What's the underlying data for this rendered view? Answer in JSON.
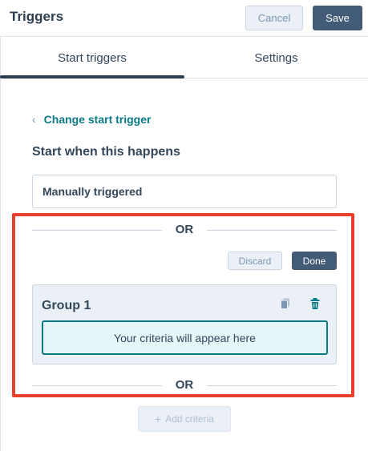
{
  "header": {
    "title": "Triggers",
    "cancel_label": "Cancel",
    "save_label": "Save"
  },
  "tabs": [
    {
      "label": "Start triggers",
      "active": true
    },
    {
      "label": "Settings",
      "active": false
    }
  ],
  "back_link": {
    "chevron": "‹",
    "label": "Change start trigger"
  },
  "section": {
    "heading": "Start when this happens",
    "trigger_value": "Manually triggered"
  },
  "or_label": "OR",
  "editor": {
    "discard_label": "Discard",
    "done_label": "Done",
    "group": {
      "title": "Group 1",
      "copy_icon": "copy-icon",
      "delete_icon": "trash-icon",
      "placeholder": "Your criteria will appear here"
    },
    "or_label_bottom": "OR"
  },
  "add_criteria": {
    "plus": "+",
    "label": "Add criteria",
    "enabled": false
  },
  "colors": {
    "primary_dark": "#425b76",
    "link_teal": "#0b7a87",
    "highlight_red": "#e8402c",
    "text": "#33475b"
  }
}
